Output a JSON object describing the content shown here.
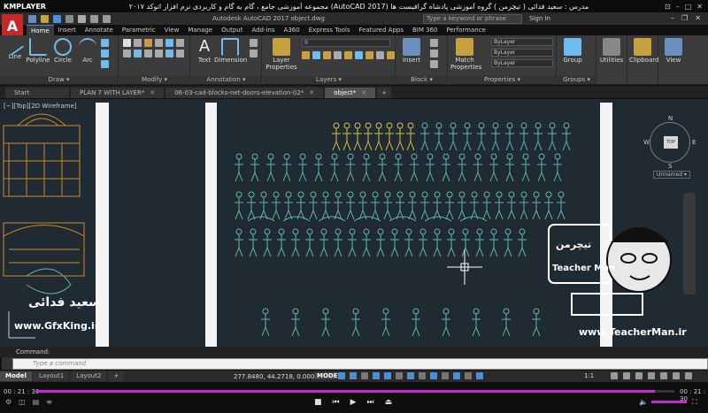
{
  "player": {
    "logo": "KMPLAYER",
    "caption": "مجموعه آموزشی جامع ، گام به گام و کاربردی نرم افزار اتوکد ۲۰۱۷ (AutoCAD 2017) مدرس : سعید فدائی ( تیچرمن ) گروه آموزشی پادشاه گرافیست ها",
    "time_elapsed": "00 : 21 : 30",
    "time_total": "00 : 21 : 30",
    "progress": 0.97
  },
  "acad": {
    "app_letter": "A",
    "title": "Autodesk AutoCAD 2017   object.dwg",
    "search_placeholder": "Type a keyword or phrase",
    "sign_in": "Sign In"
  },
  "ribbon_tabs": [
    "Home",
    "Insert",
    "Annotate",
    "Parametric",
    "View",
    "Manage",
    "Output",
    "Add-ins",
    "A360",
    "Express Tools",
    "Featured Apps",
    "BIM 360",
    "Performance"
  ],
  "ribbon": {
    "draw": {
      "label": "Draw ▾",
      "tools": [
        "Line",
        "Polyline",
        "Circle",
        "Arc"
      ]
    },
    "modify": {
      "label": "Modify ▾"
    },
    "annotation": {
      "label": "Annotation ▾",
      "tools": [
        "Text",
        "Dimension"
      ]
    },
    "layers": {
      "label": "Layers ▾",
      "tool": "Layer Properties",
      "current_layer": "0"
    },
    "block": {
      "label": "Block ▾",
      "tool": "Insert"
    },
    "properties": {
      "label": "Properties ▾",
      "tool": "Match Properties",
      "color": "ByLayer",
      "linetype": "ByLayer",
      "lineweight": "ByLayer"
    },
    "groups": {
      "label": "Groups ▾",
      "tool": "Group"
    },
    "utilities": "Utilities",
    "clipboard": "Clipboard",
    "view": "View"
  },
  "doc_tabs": [
    {
      "label": "Start",
      "active": false
    },
    {
      "label": "PLAN 7 WITH LAYER*",
      "active": false
    },
    {
      "label": "06-03-cad-blocks-net-doors-elevation-02*",
      "active": false
    },
    {
      "label": "object*",
      "active": true
    }
  ],
  "viewport": {
    "label": "[−][Top][2D Wireframe]",
    "navcube_top": "TOP",
    "compass": {
      "n": "N",
      "s": "S",
      "e": "E",
      "w": "W"
    },
    "ucs_name": "Unnamed ▾"
  },
  "watermarks": {
    "gfxking": "www.GfxKing.ir",
    "teacher_site": "www.TeacherMan.ir",
    "instructor_name": "سعید فدائی",
    "logo_text": "Teacher Man",
    "logo_fa": "تیچرمن"
  },
  "command": {
    "history": "Command:",
    "placeholder": "Type a command"
  },
  "status": {
    "layout_tabs": [
      "Model",
      "Layout1",
      "Layout2"
    ],
    "add_tab": "+",
    "coords": "277.8480, 44.2718, 0.0000",
    "model": "MODEL",
    "scale": "1:1"
  },
  "colors": {
    "app_red": "#c8272a",
    "accent_blue": "#4c8fd6",
    "seek_purple": "#c02bd6",
    "drawing_bg": "#1f2a33",
    "figure_cyan": "#5fb8b0",
    "figure_yellow": "#d8c24a",
    "figure_orange": "#c98a2a"
  }
}
